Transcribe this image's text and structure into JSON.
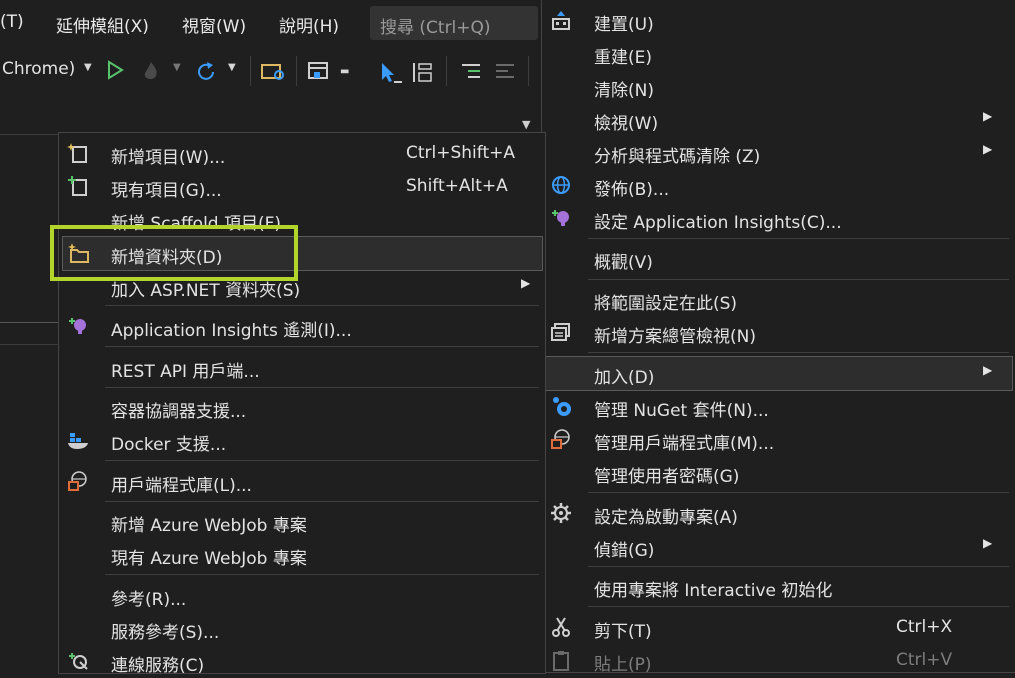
{
  "menubar": {
    "items": [
      "(T)",
      "延伸模組(X)",
      "視窗(W)",
      "說明(H)"
    ],
    "search_placeholder": "搜尋 (Ctrl+Q)"
  },
  "toolbar": {
    "browser_label": "Chrome)",
    "icons": [
      "dropdown-icon",
      "run-icon",
      "hot-reload-icon",
      "refresh-icon",
      "folder-search-icon",
      "window-layout-icon",
      "pointer-icon",
      "align-icon",
      "indent-icon",
      "outdent-icon"
    ]
  },
  "main_menu": {
    "items": [
      {
        "label": "建置(U)",
        "icon": "build-icon"
      },
      {
        "label": "重建(E)"
      },
      {
        "label": "清除(N)"
      },
      {
        "label": "檢視(W)",
        "submenu": true
      },
      {
        "label": "分析與程式碼清除 (Z)",
        "submenu": true
      },
      {
        "label": "發佈(B)...",
        "icon": "publish-globe-icon"
      },
      {
        "label": "設定 Application Insights(C)...",
        "icon": "app-insights-icon"
      },
      {
        "label": "概觀(V)"
      },
      {
        "label": "將範圍設定在此(S)"
      },
      {
        "label": "新增方案總管檢視(N)",
        "icon": "solution-view-icon"
      },
      {
        "label": "加入(D)",
        "submenu": true
      },
      {
        "label": "管理 NuGet 套件(N)...",
        "icon": "nuget-icon"
      },
      {
        "label": "管理用戶端程式庫(M)...",
        "icon": "client-library-icon"
      },
      {
        "label": "管理使用者密碼(G)"
      },
      {
        "label": "設定為啟動專案(A)",
        "icon": "gear-icon"
      },
      {
        "label": "偵錯(G)",
        "submenu": true
      },
      {
        "label": "使用專案將 Interactive 初始化"
      },
      {
        "label": "剪下(T)",
        "shortcut": "Ctrl+X",
        "icon": "scissors-icon"
      },
      {
        "label": "貼上(P)",
        "shortcut": "Ctrl+V",
        "icon": "paste-icon",
        "disabled": true
      }
    ]
  },
  "add_submenu": {
    "items": [
      {
        "label": "新增項目(W)...",
        "shortcut": "Ctrl+Shift+A",
        "icon": "new-item-icon"
      },
      {
        "label": "現有項目(G)...",
        "shortcut": "Shift+Alt+A",
        "icon": "existing-item-icon"
      },
      {
        "label": "新增 Scaffold 項目(F)..."
      },
      {
        "label": "新增資料夾(D)",
        "icon": "new-folder-icon"
      },
      {
        "label": "加入 ASP.NET 資料夾(S)",
        "submenu": true
      },
      {
        "label": "Application Insights 遙測(I)...",
        "icon": "app-insights-icon"
      },
      {
        "label": "REST API 用戶端..."
      },
      {
        "label": "容器協調器支援..."
      },
      {
        "label": "Docker 支援...",
        "icon": "docker-icon"
      },
      {
        "label": "用戶端程式庫(L)...",
        "icon": "client-library-icon"
      },
      {
        "label": "新增 Azure WebJob 專案"
      },
      {
        "label": "現有 Azure WebJob 專案"
      },
      {
        "label": "參考(R)..."
      },
      {
        "label": "服務參考(S)..."
      },
      {
        "label": "連線服務(C)",
        "icon": "connected-service-icon"
      }
    ]
  },
  "colors": {
    "background": "#1f1f1f",
    "highlight_border": "#b3d42a",
    "text": "#e3e3e3",
    "disabled_text": "#7d7d7d",
    "accent_blue": "#3b9cff",
    "run_green": "#59c26d"
  }
}
